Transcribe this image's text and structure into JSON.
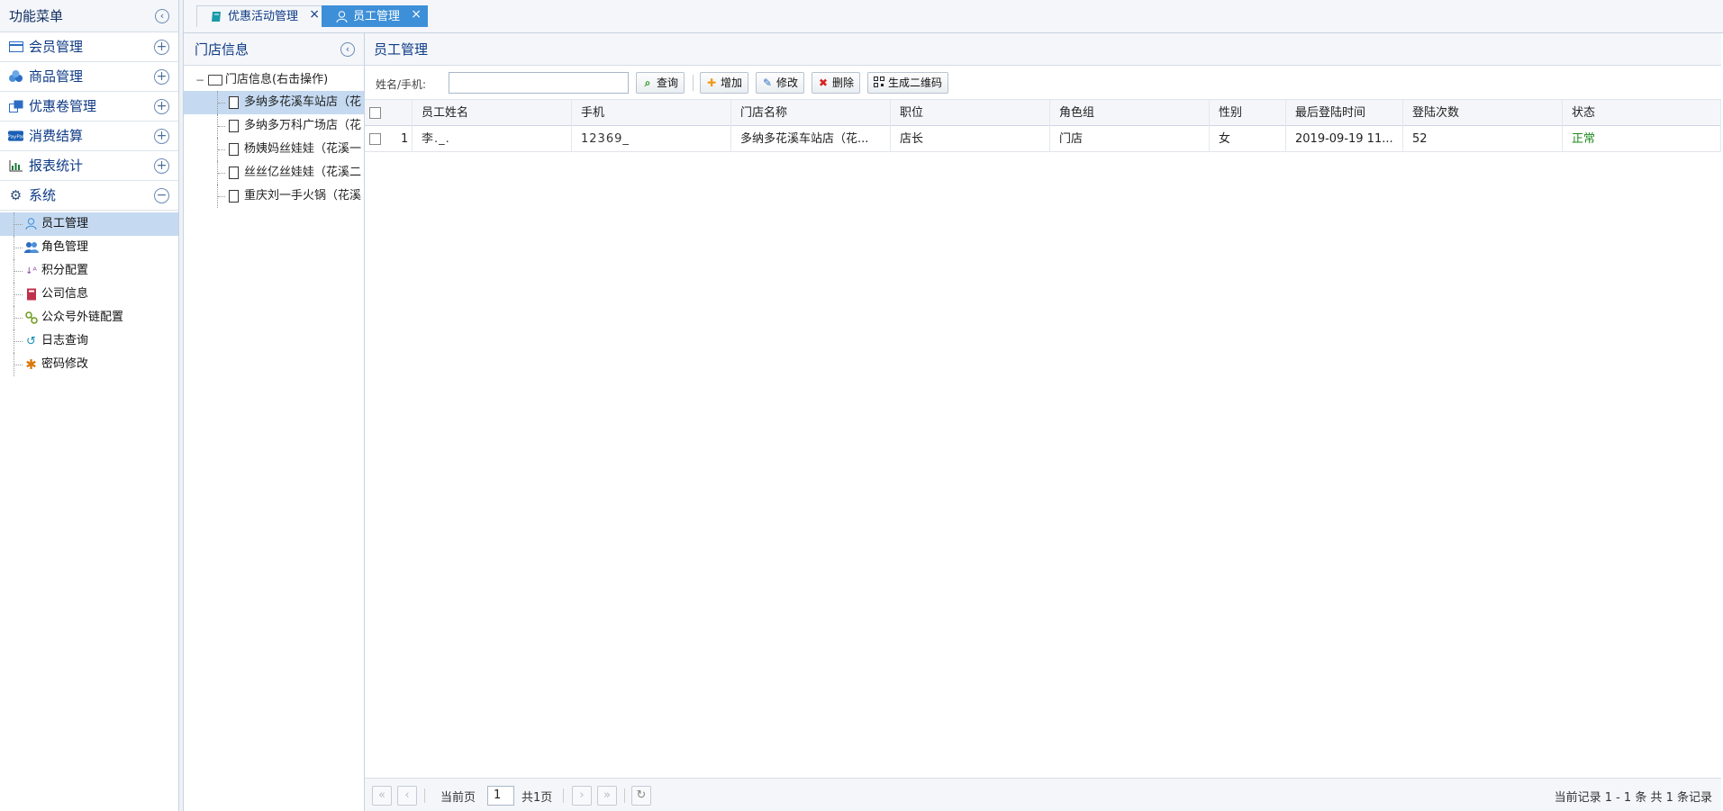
{
  "menu": {
    "title": "功能菜单",
    "groups": [
      {
        "label": "会员管理",
        "icon": "card-icon",
        "color": "#2b6cc4"
      },
      {
        "label": "商品管理",
        "icon": "boxes-icon",
        "color": "#2b6cc4"
      },
      {
        "label": "优惠卷管理",
        "icon": "coupon-icon",
        "color": "#2b6cc4"
      },
      {
        "label": "消费结算",
        "icon": "paypal-icon",
        "color": "#1a5fb4"
      },
      {
        "label": "报表统计",
        "icon": "bar-chart-icon",
        "color": "#1a7a3a"
      },
      {
        "label": "系统",
        "icon": "gear-icon",
        "color": "#2b4a7a"
      }
    ],
    "system_items": [
      {
        "label": "员工管理",
        "icon": "person-icon"
      },
      {
        "label": "角色管理",
        "icon": "users-icon"
      },
      {
        "label": "积分配置",
        "icon": "sort-az-icon"
      },
      {
        "label": "公司信息",
        "icon": "book-icon"
      },
      {
        "label": "公众号外链配置",
        "icon": "link-icon"
      },
      {
        "label": "日志查询",
        "icon": "history-icon"
      },
      {
        "label": "密码修改",
        "icon": "asterisk-icon"
      }
    ]
  },
  "tabs": [
    {
      "label": "优惠活动管理",
      "icon": "book-icon"
    },
    {
      "label": "员工管理",
      "icon": "person-icon"
    }
  ],
  "close_glyph": "×",
  "store_panel": {
    "title": "门店信息",
    "root_label": "门店信息(右击操作)",
    "stores": [
      "多纳多花溪车站店（花",
      "多纳多万科广场店（花",
      "杨姨妈丝娃娃（花溪一",
      "丝丝亿丝娃娃（花溪二",
      "重庆刘一手火锅（花溪"
    ]
  },
  "main": {
    "title": "员工管理",
    "toolbar": {
      "search_label": "姓名/手机:",
      "search_value": "",
      "query": "查询",
      "add": "增加",
      "edit": "修改",
      "delete": "删除",
      "qrcode": "生成二维码"
    },
    "columns": [
      "员工姓名",
      "手机",
      "门店名称",
      "职位",
      "角色组",
      "性别",
      "最后登陆时间",
      "登陆次数",
      "状态"
    ],
    "rows": [
      {
        "index": "1",
        "name": "李._.",
        "phone": "12369_",
        "store": "多纳多花溪车站店（花...",
        "position": "店长",
        "role": "门店",
        "gender": "女",
        "last_login": "2019-09-19 11...",
        "login_count": "52",
        "status": "正常"
      }
    ]
  },
  "pager": {
    "current_label": "当前页",
    "page": "1",
    "total_label": "共1页",
    "summary": "当前记录 1 - 1 条 共 1 条记录"
  }
}
